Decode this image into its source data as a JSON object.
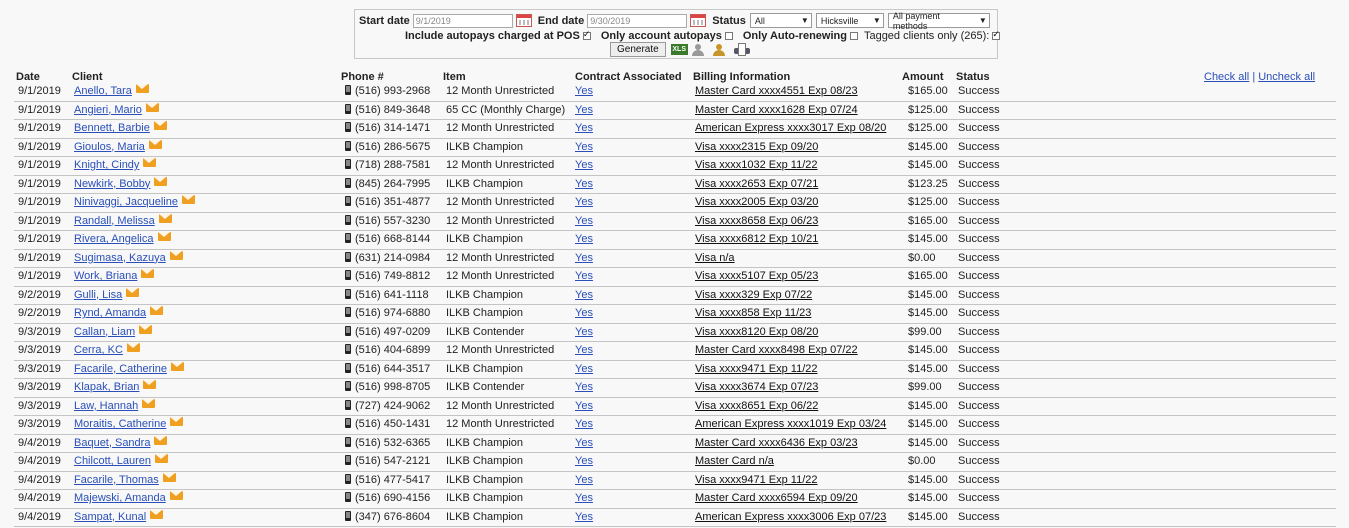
{
  "filters": {
    "start_date_label": "Start date",
    "start_date_value": "9/1/2019",
    "end_date_label": "End date",
    "end_date_value": "9/30/2019",
    "status_label": "Status",
    "status_value": "All",
    "location_value": "Hicksville",
    "payment_value": "All payment methods",
    "include_autopays_label": "Include autopays charged at POS",
    "include_autopays_checked": true,
    "only_account_autopays_label": "Only account autopays",
    "only_account_autopays_checked": false,
    "only_auto_renewing_label": "Only Auto-renewing",
    "only_auto_renewing_checked": false,
    "tagged_clients_label": "Tagged clients only (265):",
    "tagged_clients_checked": true,
    "generate_label": "Generate",
    "xls_label": "XLS"
  },
  "links": {
    "check_all": "Check all",
    "separator": "|",
    "uncheck_all": "Uncheck all"
  },
  "columns": [
    "Date",
    "Client",
    "Phone #",
    "Item",
    "Contract Associated",
    "Billing Information",
    "Amount",
    "Status"
  ],
  "rows": [
    {
      "date": "9/1/2019",
      "client": "Anello, Tara",
      "phone": "(516) 993-2968",
      "item": "12 Month Unrestricted",
      "contract": "Yes",
      "billing": "Master Card xxxx4551 Exp 08/23",
      "amount": "$165.00",
      "status": "Success"
    },
    {
      "date": "9/1/2019",
      "client": "Angieri, Mario",
      "phone": "(516) 849-3648",
      "item": "65 CC (Monthly Charge)",
      "contract": "Yes",
      "billing": "Master Card xxxx1628 Exp 07/24",
      "amount": "$125.00",
      "status": "Success"
    },
    {
      "date": "9/1/2019",
      "client": "Bennett, Barbie",
      "phone": "(516) 314-1471",
      "item": "12 Month Unrestricted",
      "contract": "Yes",
      "billing": "American Express xxxx3017 Exp 08/20",
      "amount": "$125.00",
      "status": "Success"
    },
    {
      "date": "9/1/2019",
      "client": "Gioulos, Maria",
      "phone": "(516) 286-5675",
      "item": "ILKB Champion",
      "contract": "Yes",
      "billing": "Visa xxxx2315 Exp 09/20",
      "amount": "$145.00",
      "status": "Success"
    },
    {
      "date": "9/1/2019",
      "client": "Knight, Cindy",
      "phone": "(718) 288-7581",
      "item": "12 Month Unrestricted",
      "contract": "Yes",
      "billing": "Visa xxxx1032 Exp 11/22",
      "amount": "$145.00",
      "status": "Success"
    },
    {
      "date": "9/1/2019",
      "client": "Newkirk, Bobby",
      "phone": "(845) 264-7995",
      "item": "ILKB Champion",
      "contract": "Yes",
      "billing": "Visa xxxx2653 Exp 07/21",
      "amount": "$123.25",
      "status": "Success"
    },
    {
      "date": "9/1/2019",
      "client": "Ninivaggi, Jacqueline",
      "phone": "(516) 351-4877",
      "item": "12 Month Unrestricted",
      "contract": "Yes",
      "billing": "Visa xxxx2005 Exp 03/20",
      "amount": "$125.00",
      "status": "Success"
    },
    {
      "date": "9/1/2019",
      "client": "Randall, Melissa",
      "phone": "(516) 557-3230",
      "item": "12 Month Unrestricted",
      "contract": "Yes",
      "billing": "Visa xxxx8658 Exp 06/23",
      "amount": "$165.00",
      "status": "Success"
    },
    {
      "date": "9/1/2019",
      "client": "Rivera, Angelica",
      "phone": "(516) 668-8144",
      "item": "ILKB Champion",
      "contract": "Yes",
      "billing": "Visa xxxx6812 Exp 10/21",
      "amount": "$145.00",
      "status": "Success"
    },
    {
      "date": "9/1/2019",
      "client": "Sugimasa, Kazuya",
      "phone": "(631) 214-0984",
      "item": "12 Month Unrestricted",
      "contract": "Yes",
      "billing": "Visa n/a",
      "amount": "$0.00",
      "status": "Success"
    },
    {
      "date": "9/1/2019",
      "client": "Work, Briana",
      "phone": "(516) 749-8812",
      "item": "12 Month Unrestricted",
      "contract": "Yes",
      "billing": "Visa xxxx5107 Exp 05/23",
      "amount": "$165.00",
      "status": "Success"
    },
    {
      "date": "9/2/2019",
      "client": "Gulli, Lisa",
      "phone": "(516) 641-1118",
      "item": "ILKB Champion",
      "contract": "Yes",
      "billing": "Visa xxxx329 Exp 07/22",
      "amount": "$145.00",
      "status": "Success"
    },
    {
      "date": "9/2/2019",
      "client": "Rynd, Amanda",
      "phone": "(516) 974-6880",
      "item": "ILKB Champion",
      "contract": "Yes",
      "billing": "Visa xxxx858 Exp 11/23",
      "amount": "$145.00",
      "status": "Success"
    },
    {
      "date": "9/3/2019",
      "client": "Callan, Liam",
      "phone": "(516) 497-0209",
      "item": "ILKB Contender",
      "contract": "Yes",
      "billing": "Visa xxxx8120 Exp 08/20",
      "amount": "$99.00",
      "status": "Success"
    },
    {
      "date": "9/3/2019",
      "client": "Cerra, KC",
      "phone": "(516) 404-6899",
      "item": "12 Month Unrestricted",
      "contract": "Yes",
      "billing": "Master Card xxxx8498 Exp 07/22",
      "amount": "$145.00",
      "status": "Success"
    },
    {
      "date": "9/3/2019",
      "client": "Facarile, Catherine",
      "phone": "(516) 644-3517",
      "item": "ILKB Champion",
      "contract": "Yes",
      "billing": "Visa xxxx9471 Exp 11/22",
      "amount": "$145.00",
      "status": "Success"
    },
    {
      "date": "9/3/2019",
      "client": "Klapak, Brian",
      "phone": "(516) 998-8705",
      "item": "ILKB Contender",
      "contract": "Yes",
      "billing": "Visa xxxx3674 Exp 07/23",
      "amount": "$99.00",
      "status": "Success"
    },
    {
      "date": "9/3/2019",
      "client": "Law, Hannah",
      "phone": "(727) 424-9062",
      "item": "12 Month Unrestricted",
      "contract": "Yes",
      "billing": "Visa xxxx8651 Exp 06/22",
      "amount": "$145.00",
      "status": "Success"
    },
    {
      "date": "9/3/2019",
      "client": "Moraitis, Catherine",
      "phone": "(516) 450-1431",
      "item": "12 Month Unrestricted",
      "contract": "Yes",
      "billing": "American Express xxxx1019 Exp 03/24",
      "amount": "$145.00",
      "status": "Success"
    },
    {
      "date": "9/4/2019",
      "client": "Baquet, Sandra",
      "phone": "(516) 532-6365",
      "item": "ILKB Champion",
      "contract": "Yes",
      "billing": "Master Card xxxx6436 Exp 03/23",
      "amount": "$145.00",
      "status": "Success"
    },
    {
      "date": "9/4/2019",
      "client": "Chilcott, Lauren",
      "phone": "(516) 547-2121",
      "item": "ILKB Champion",
      "contract": "Yes",
      "billing": "Master Card n/a",
      "amount": "$0.00",
      "status": "Success"
    },
    {
      "date": "9/4/2019",
      "client": "Facarile, Thomas",
      "phone": "(516) 477-5417",
      "item": "ILKB Champion",
      "contract": "Yes",
      "billing": "Visa xxxx9471 Exp 11/22",
      "amount": "$145.00",
      "status": "Success"
    },
    {
      "date": "9/4/2019",
      "client": "Majewski, Amanda",
      "phone": "(516) 690-4156",
      "item": "ILKB Champion",
      "contract": "Yes",
      "billing": "Master Card xxxx6594 Exp 09/20",
      "amount": "$145.00",
      "status": "Success"
    },
    {
      "date": "9/4/2019",
      "client": "Sampat, Kunal",
      "phone": "(347) 676-8604",
      "item": "ILKB Champion",
      "contract": "Yes",
      "billing": "American Express xxxx3006 Exp 07/23",
      "amount": "$145.00",
      "status": "Success"
    }
  ],
  "icons": {
    "calendar": "calendar-icon",
    "email": "email-icon",
    "phone": "mobile-phone-icon",
    "excel": "excel-export-icon",
    "users": "users-icon",
    "print": "print-icon"
  },
  "colors": {
    "link": "#2a4fb8",
    "mail_icon": "#f0a020",
    "background": "#f8f8f8"
  }
}
